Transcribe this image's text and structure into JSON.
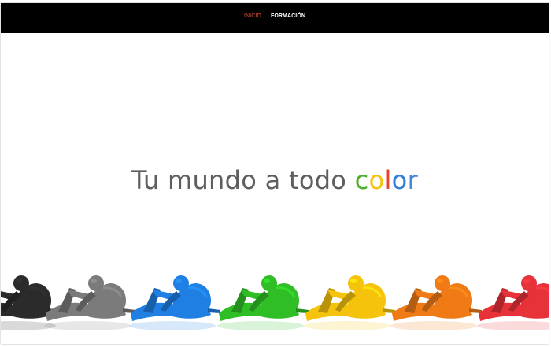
{
  "nav": {
    "items": [
      {
        "label": "INICIO",
        "active": true,
        "color": "#e8513a"
      },
      {
        "label": "FORMACIÓN",
        "active": false,
        "color": "#ffffff"
      }
    ]
  },
  "hero": {
    "text_main": "Tu mundo a todo ",
    "color_letters": [
      {
        "char": "c",
        "color": "#4caf2e"
      },
      {
        "char": "o",
        "color": "#f3c20b"
      },
      {
        "char": "l",
        "color": "#e8412e"
      },
      {
        "char": "o",
        "color": "#2f7fe0"
      },
      {
        "char": "r",
        "color": "#4a86d6"
      }
    ]
  },
  "figures": {
    "image": "row of reclining figurines",
    "colors": [
      "#2b2b2b",
      "#7b7b7b",
      "#1f7fe3",
      "#2fbe25",
      "#f5c30c",
      "#f07a16",
      "#e8323a"
    ]
  }
}
